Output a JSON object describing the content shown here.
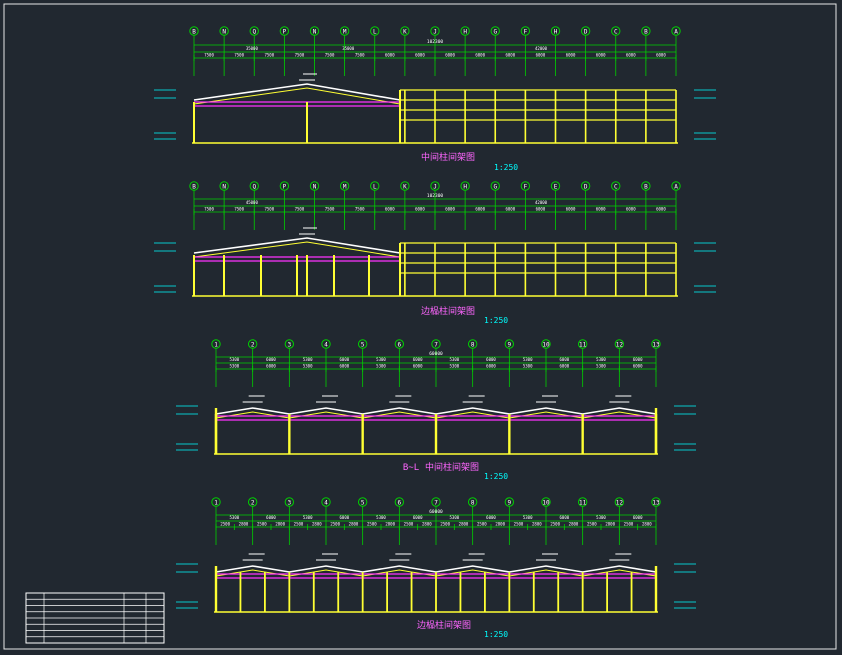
{
  "colors": {
    "background": "#212830",
    "frame": "#e8e8e8",
    "axis_line": "#00d000",
    "axis_bubble": "#00d000",
    "axis_text": "#ffffff",
    "dim_line": "#00d000",
    "dim_text": "#ffffff",
    "column": "#ffff33",
    "bracing": "#ff33ff",
    "roof": "#ffffff",
    "level_mark": "#00ffff",
    "title_text": "#ff66ff",
    "scale_text": "#00ffff",
    "table_line": "#ffffff"
  },
  "drawings": [
    {
      "title": "中间柱间架图",
      "scale": "1:250",
      "axes": [
        "B",
        "N",
        "Q",
        "P",
        "N",
        "M",
        "L",
        "K",
        "J",
        "H",
        "G",
        "F",
        "H",
        "D",
        "C",
        "B",
        "A"
      ],
      "total_dim": "102300",
      "sub_dims": [
        "35000",
        "35000",
        "42000"
      ],
      "spans": [
        "7500",
        "7500",
        "7500",
        "7500",
        "7500",
        "7500",
        "6000",
        "6000",
        "6000",
        "6000",
        "6000",
        "6000",
        "6000",
        "6000",
        "6000",
        "6000"
      ]
    },
    {
      "title": "边榀柱间架图",
      "scale": "1:250",
      "axes": [
        "B",
        "N",
        "Q",
        "P",
        "N",
        "M",
        "L",
        "K",
        "J",
        "H",
        "G",
        "F",
        "E",
        "D",
        "C",
        "B",
        "A"
      ],
      "total_dim": "102300",
      "sub_dims": [
        "45000",
        "42000"
      ],
      "spans": [
        "7500",
        "7500",
        "7500",
        "7500",
        "7500",
        "7500",
        "6000",
        "6000",
        "6000",
        "6000",
        "6000",
        "6000",
        "6000",
        "6000",
        "6000",
        "6000"
      ]
    },
    {
      "title_axis": "B~L",
      "title": "中间柱间架图",
      "scale": "1:250",
      "axes": [
        "1",
        "2",
        "3",
        "4",
        "5",
        "6",
        "7",
        "8",
        "9",
        "10",
        "11",
        "12",
        "13"
      ],
      "total_dim": "60000",
      "upper_dims": [
        "5300",
        "6000",
        "5300",
        "6000",
        "5300",
        "6000",
        "5300",
        "6000",
        "5300",
        "6000",
        "5300",
        "6000"
      ],
      "spans": [
        "5300",
        "6000",
        "5300",
        "6000",
        "5300",
        "6000",
        "5300",
        "6000",
        "5300",
        "6000",
        "5300",
        "6000"
      ]
    },
    {
      "title": "边榀柱间架图",
      "scale": "1:250",
      "axes": [
        "1",
        "2",
        "3",
        "4",
        "5",
        "6",
        "7",
        "8",
        "9",
        "10",
        "11",
        "12",
        "13"
      ],
      "total_dim": "60000",
      "upper_dims": [
        "5300",
        "6000",
        "5300",
        "6000",
        "5300",
        "6000",
        "5300",
        "6000",
        "5300",
        "6000",
        "5300",
        "6000"
      ],
      "spans": [
        "2500",
        "2800",
        "2500",
        "2800",
        "2500",
        "2800",
        "2500",
        "2800",
        "2500",
        "2800",
        "2500",
        "2800",
        "2500",
        "2800",
        "2500",
        "2800",
        "2500",
        "2800",
        "2500",
        "2800",
        "2500",
        "2800",
        "2500",
        "2800"
      ]
    }
  ],
  "title_block": {
    "rows": 8,
    "cols": 4
  }
}
